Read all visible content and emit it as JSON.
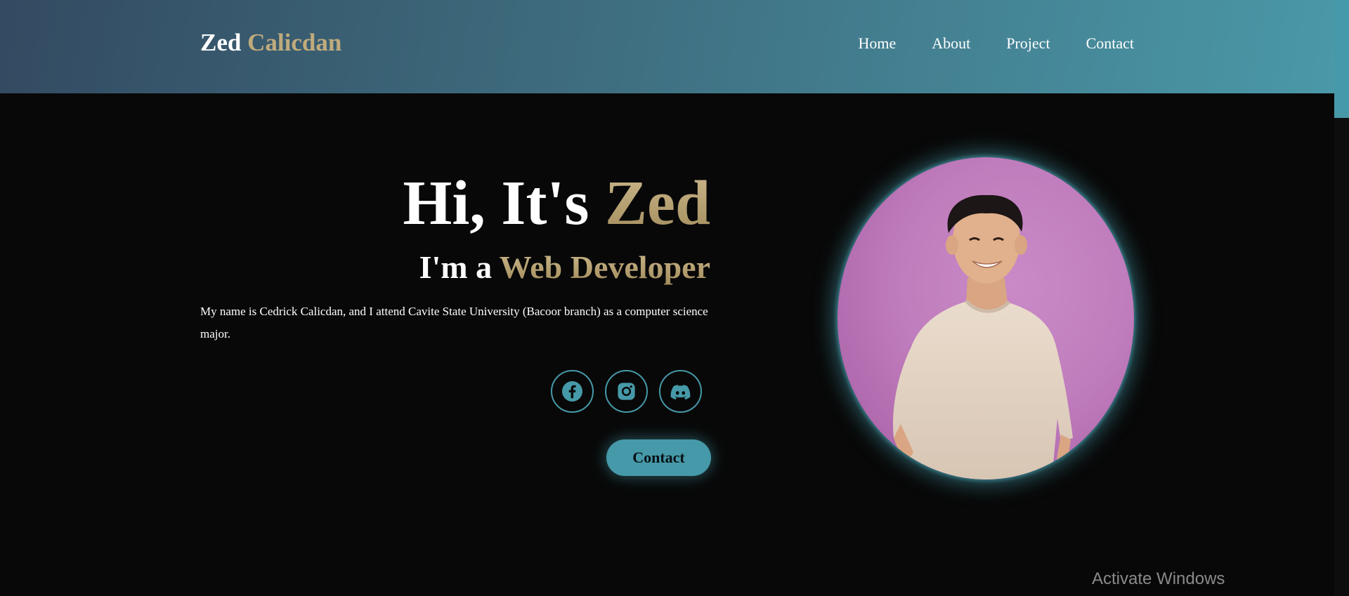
{
  "header": {
    "logo_first": "Zed",
    "logo_last": "Calicdan",
    "nav": [
      "Home",
      "About",
      "Project",
      "Contact"
    ]
  },
  "hero": {
    "greeting": "Hi, It's",
    "name": "Zed",
    "role_prefix": "I'm a",
    "role": "Web Developer",
    "description": "My name is Cedrick Calicdan, and I attend Cavite State University (Bacoor branch) as a computer science major.",
    "contact_label": "Contact"
  },
  "socials": [
    "facebook-icon",
    "instagram-icon",
    "discord-icon"
  ],
  "os_watermark": "Activate Windows",
  "colors": {
    "accent": "#4699a8",
    "gold": "#c0ab7d",
    "background": "#080808",
    "header_from": "#334a61",
    "header_to": "#4a98a8",
    "avatar_bg": "#c07dbd"
  }
}
